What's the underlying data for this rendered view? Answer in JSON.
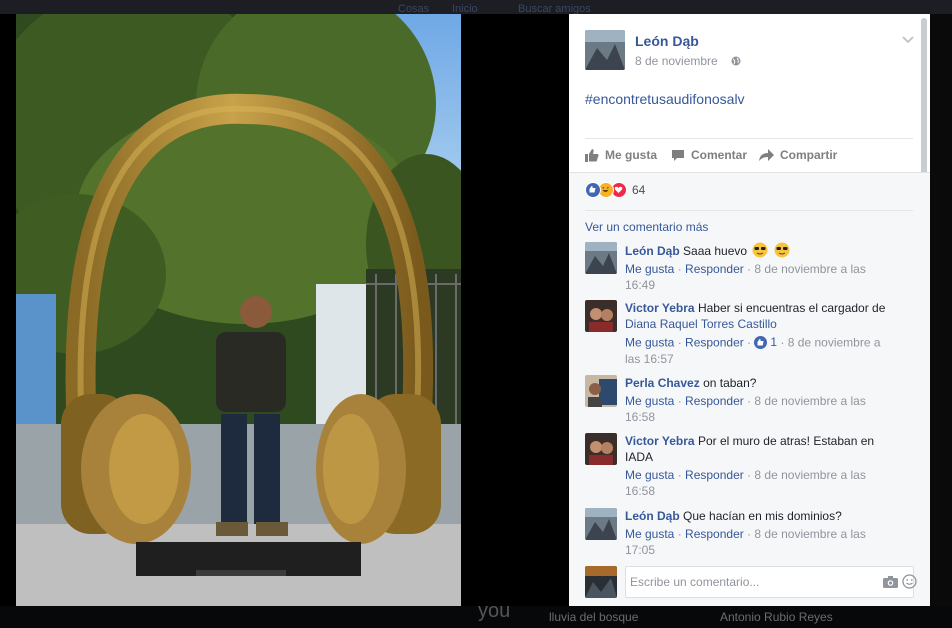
{
  "background": {
    "top_items": [
      "Cosas",
      "Inicio",
      "Buscar amigos"
    ],
    "bottom_left": "lluvia del bosque",
    "bottom_right": "Antonio Rubio Reyes",
    "caption_fragment": "you"
  },
  "post": {
    "author": "León Dąb",
    "date": "8 de noviembre",
    "text": "#encontretusaudifonosalv",
    "actions": {
      "like": "Me gusta",
      "comment": "Comentar",
      "share": "Compartir"
    },
    "reaction_count": "64",
    "reactions": [
      "like-icon",
      "haha-icon",
      "love-icon"
    ]
  },
  "comments_section": {
    "more_link": "Ver un comentario más",
    "meta_like": "Me gusta",
    "meta_reply": "Responder",
    "comments": [
      {
        "name": "León Dąb",
        "text": "Saaa huevo",
        "timestamp_line1": "8 de noviembre a las",
        "timestamp_line2": "16:49"
      },
      {
        "name": "Victor Yebra",
        "text": "Haber si encuentras el cargador de",
        "mention": "Diana Raquel Torres Castillo",
        "likes": "1",
        "timestamp_line1": "8 de noviembre a",
        "timestamp_line2": "las 16:57"
      },
      {
        "name": "Perla Chavez",
        "text": "on taban?",
        "timestamp_line1": "8 de noviembre a las",
        "timestamp_line2": "16:58"
      },
      {
        "name": "Victor Yebra",
        "text": "Por el muro de atras! Estaban en IADA",
        "timestamp_line1": "8 de noviembre a las",
        "timestamp_line2": "16:58"
      },
      {
        "name": "León Dąb",
        "text": "Que hacían en mis dominios?",
        "timestamp_line1": "8 de noviembre a las",
        "timestamp_line2": "17:05"
      }
    ],
    "write_placeholder": "Escribe un comentario..."
  },
  "colors": {
    "link": "#365899",
    "like_blue": "#4267b2",
    "love_red": "#f0284a",
    "haha_yellow": "#f7b125"
  }
}
